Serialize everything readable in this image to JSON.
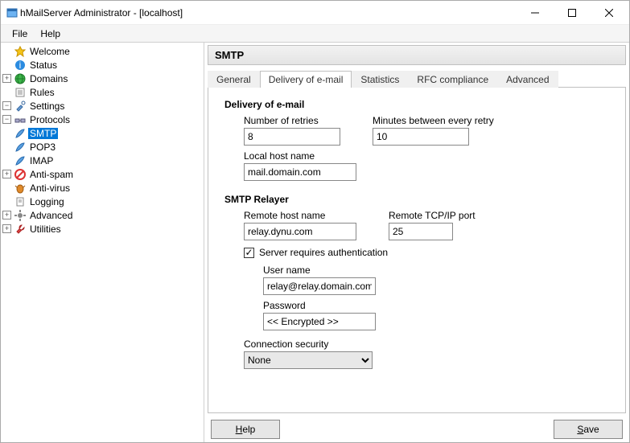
{
  "window": {
    "title": "hMailServer Administrator - [localhost]"
  },
  "menu": {
    "file": "File",
    "help": "Help"
  },
  "tree": {
    "welcome": "Welcome",
    "status": "Status",
    "domains": "Domains",
    "rules": "Rules",
    "settings": "Settings",
    "protocols": "Protocols",
    "smtp": "SMTP",
    "pop3": "POP3",
    "imap": "IMAP",
    "antispam": "Anti-spam",
    "antivirus": "Anti-virus",
    "logging": "Logging",
    "advanced": "Advanced",
    "utilities": "Utilities"
  },
  "panel": {
    "title": "SMTP"
  },
  "tabs": {
    "general": "General",
    "delivery": "Delivery of e-mail",
    "statistics": "Statistics",
    "rfc": "RFC compliance",
    "advanced": "Advanced"
  },
  "delivery": {
    "heading": "Delivery of e-mail",
    "retries_label": "Number of retries",
    "retries_value": "8",
    "minutes_label": "Minutes between every retry",
    "minutes_value": "10",
    "localhost_label": "Local host name",
    "localhost_value": "mail.domain.com"
  },
  "relayer": {
    "heading": "SMTP Relayer",
    "remote_host_label": "Remote host name",
    "remote_host_value": "relay.dynu.com",
    "remote_port_label": "Remote TCP/IP port",
    "remote_port_value": "25",
    "auth_checkbox": "Server requires authentication",
    "auth_checked": "✓",
    "username_label": "User name",
    "username_value": "relay@relay.domain.com",
    "password_label": "Password",
    "password_value": "<< Encrypted >>",
    "connsec_label": "Connection security",
    "connsec_value": "None"
  },
  "buttons": {
    "help": "elp",
    "help_u": "H",
    "save": "ave",
    "save_u": "S"
  }
}
